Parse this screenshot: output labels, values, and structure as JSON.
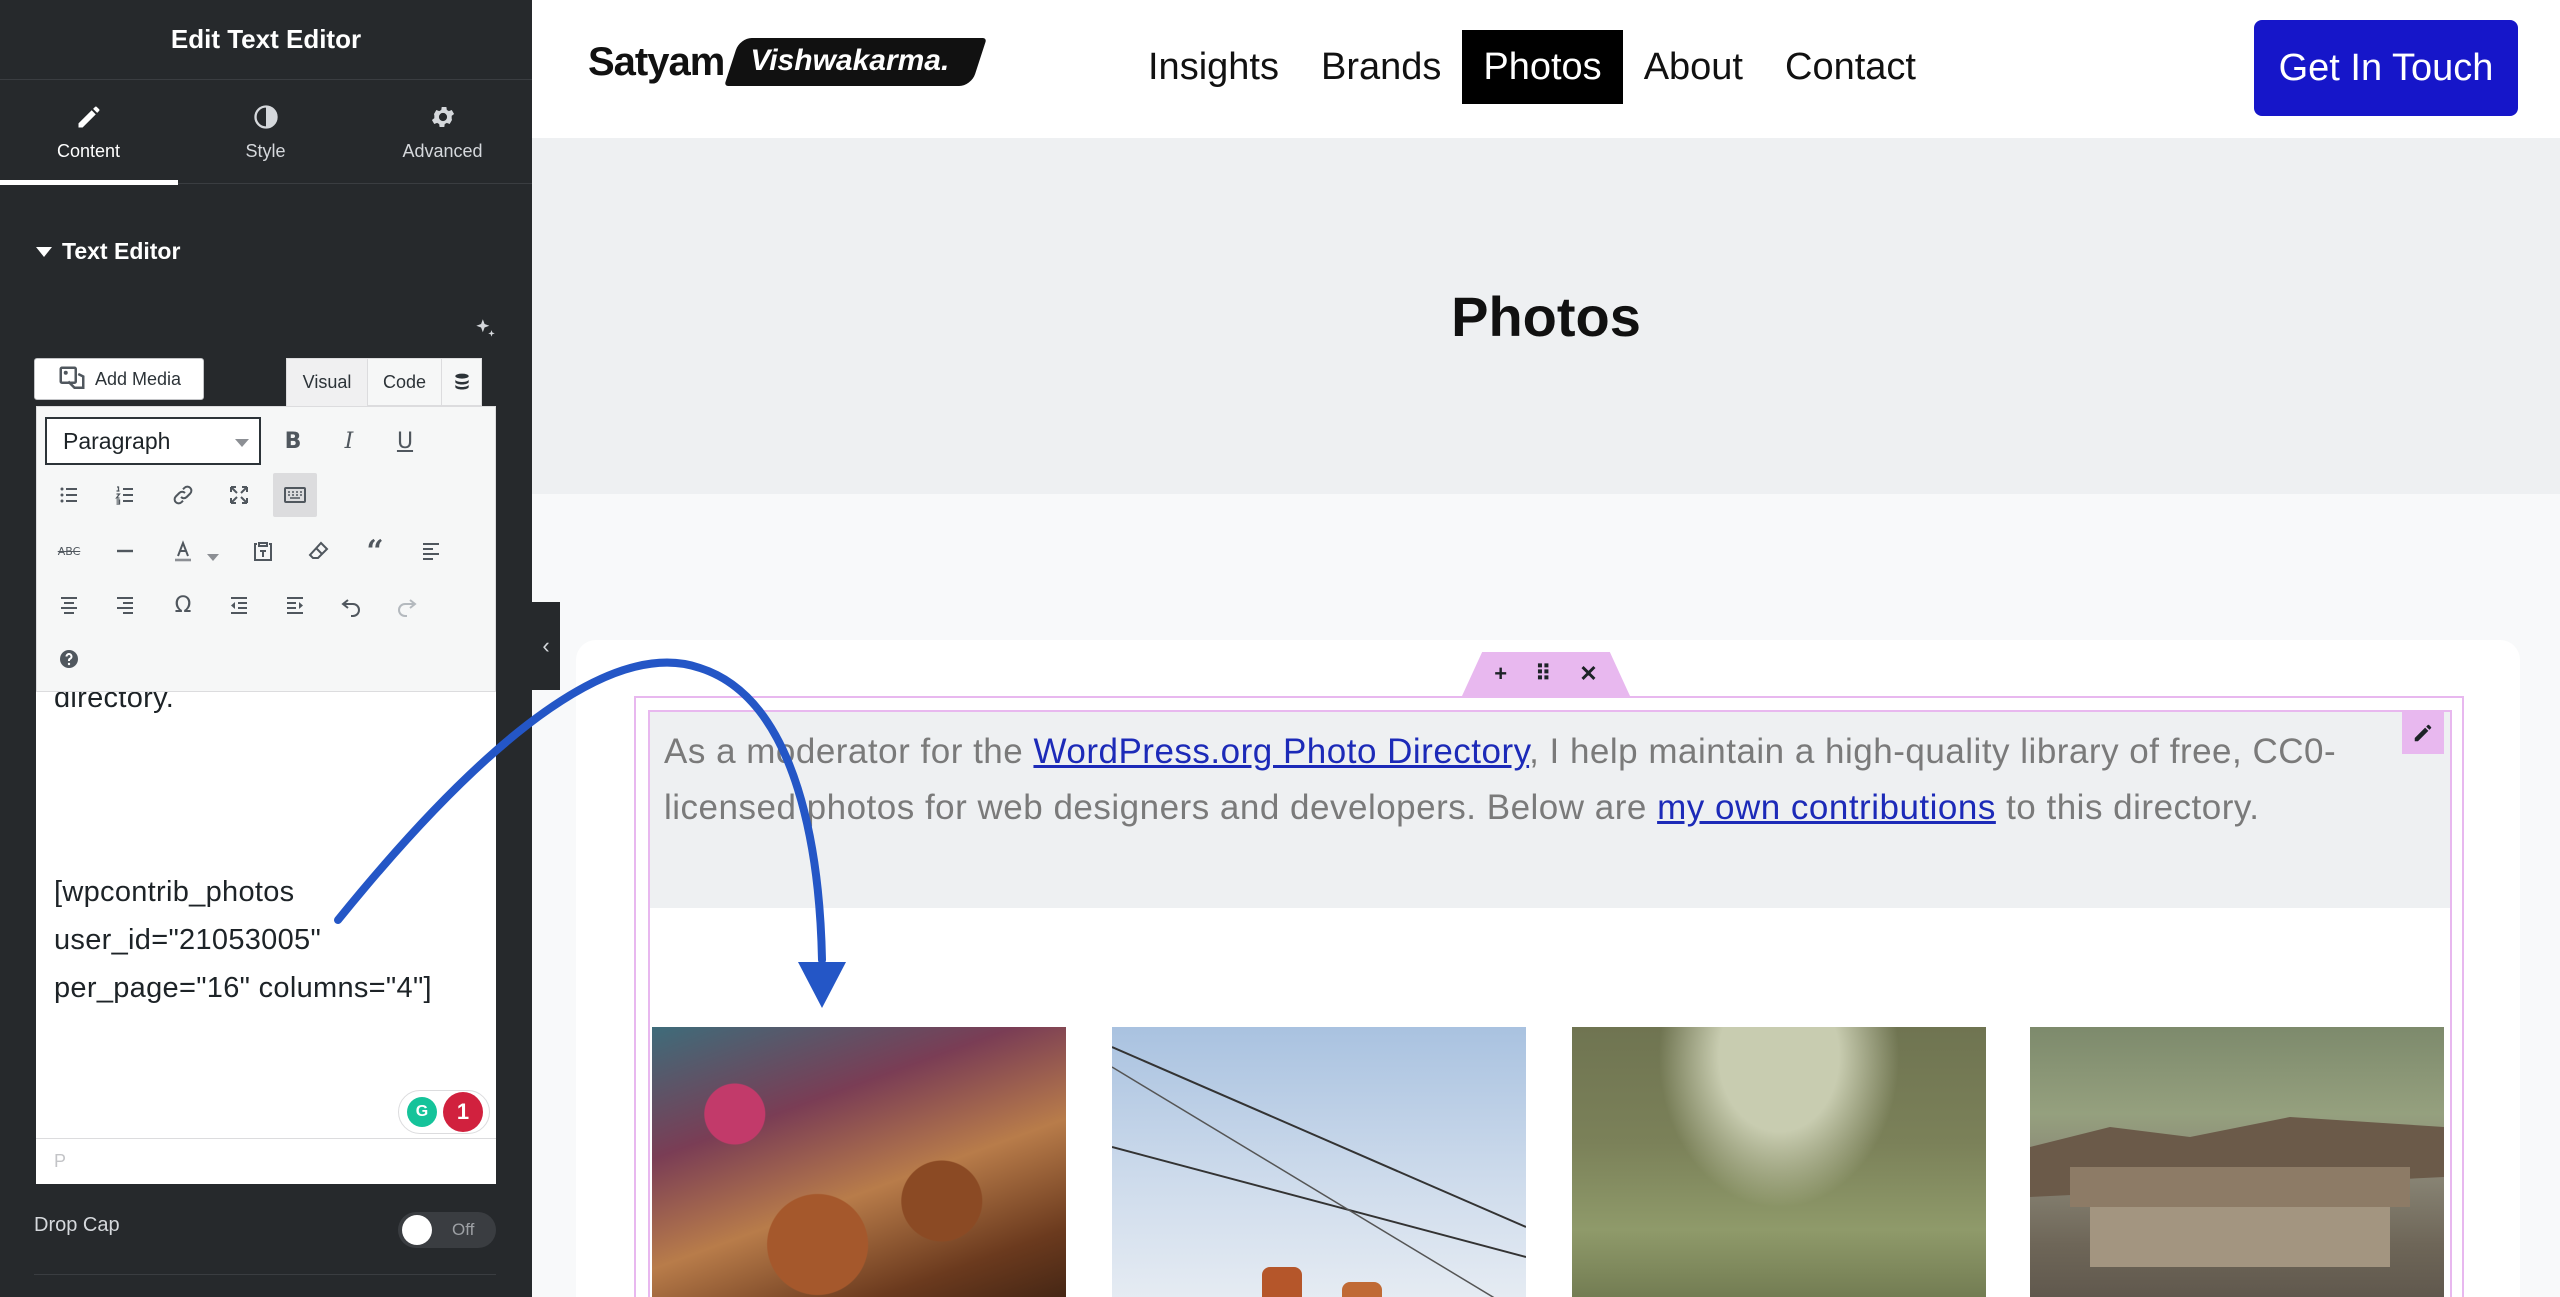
{
  "panel": {
    "title": "Edit Text Editor",
    "tabs": [
      {
        "label": "Content",
        "icon": "pencil-icon"
      },
      {
        "label": "Style",
        "icon": "half-circle-icon"
      },
      {
        "label": "Advanced",
        "icon": "gear-icon"
      }
    ],
    "section_title": "Text Editor",
    "add_media_label": "Add Media",
    "mode_visual": "Visual",
    "mode_code": "Code",
    "format_value": "Paragraph",
    "content_lines": [
      "directory.",
      "[wpcontrib_photos",
      "user_id=\"21053005\"",
      "per_page=\"16\" columns=\"4\"]"
    ],
    "grammarly_count": "1",
    "status_path": "P",
    "drop_cap_label": "Drop Cap",
    "drop_cap_state": "Off"
  },
  "site": {
    "logo_first": "Satyam",
    "logo_second": "Vishwakarma.",
    "nav": [
      "Insights",
      "Brands",
      "Photos",
      "About",
      "Contact"
    ],
    "cta": "Get In Touch",
    "page_title": "Photos",
    "paragraph": {
      "part1": "As a moderator for the ",
      "link1": "WordPress.org Photo Directory",
      "part2": ", I help maintain a high-quality library of free, CC0-licensed photos for web designers and developers. Below are ",
      "link2": "my own contributions",
      "part3": " to this directory."
    }
  },
  "colors": {
    "panel_bg": "#26292c",
    "cta_bg": "#1616c9",
    "selection": "#e8b8ef",
    "link": "#1c2ab8",
    "annotation_arrow": "#2456c6"
  }
}
